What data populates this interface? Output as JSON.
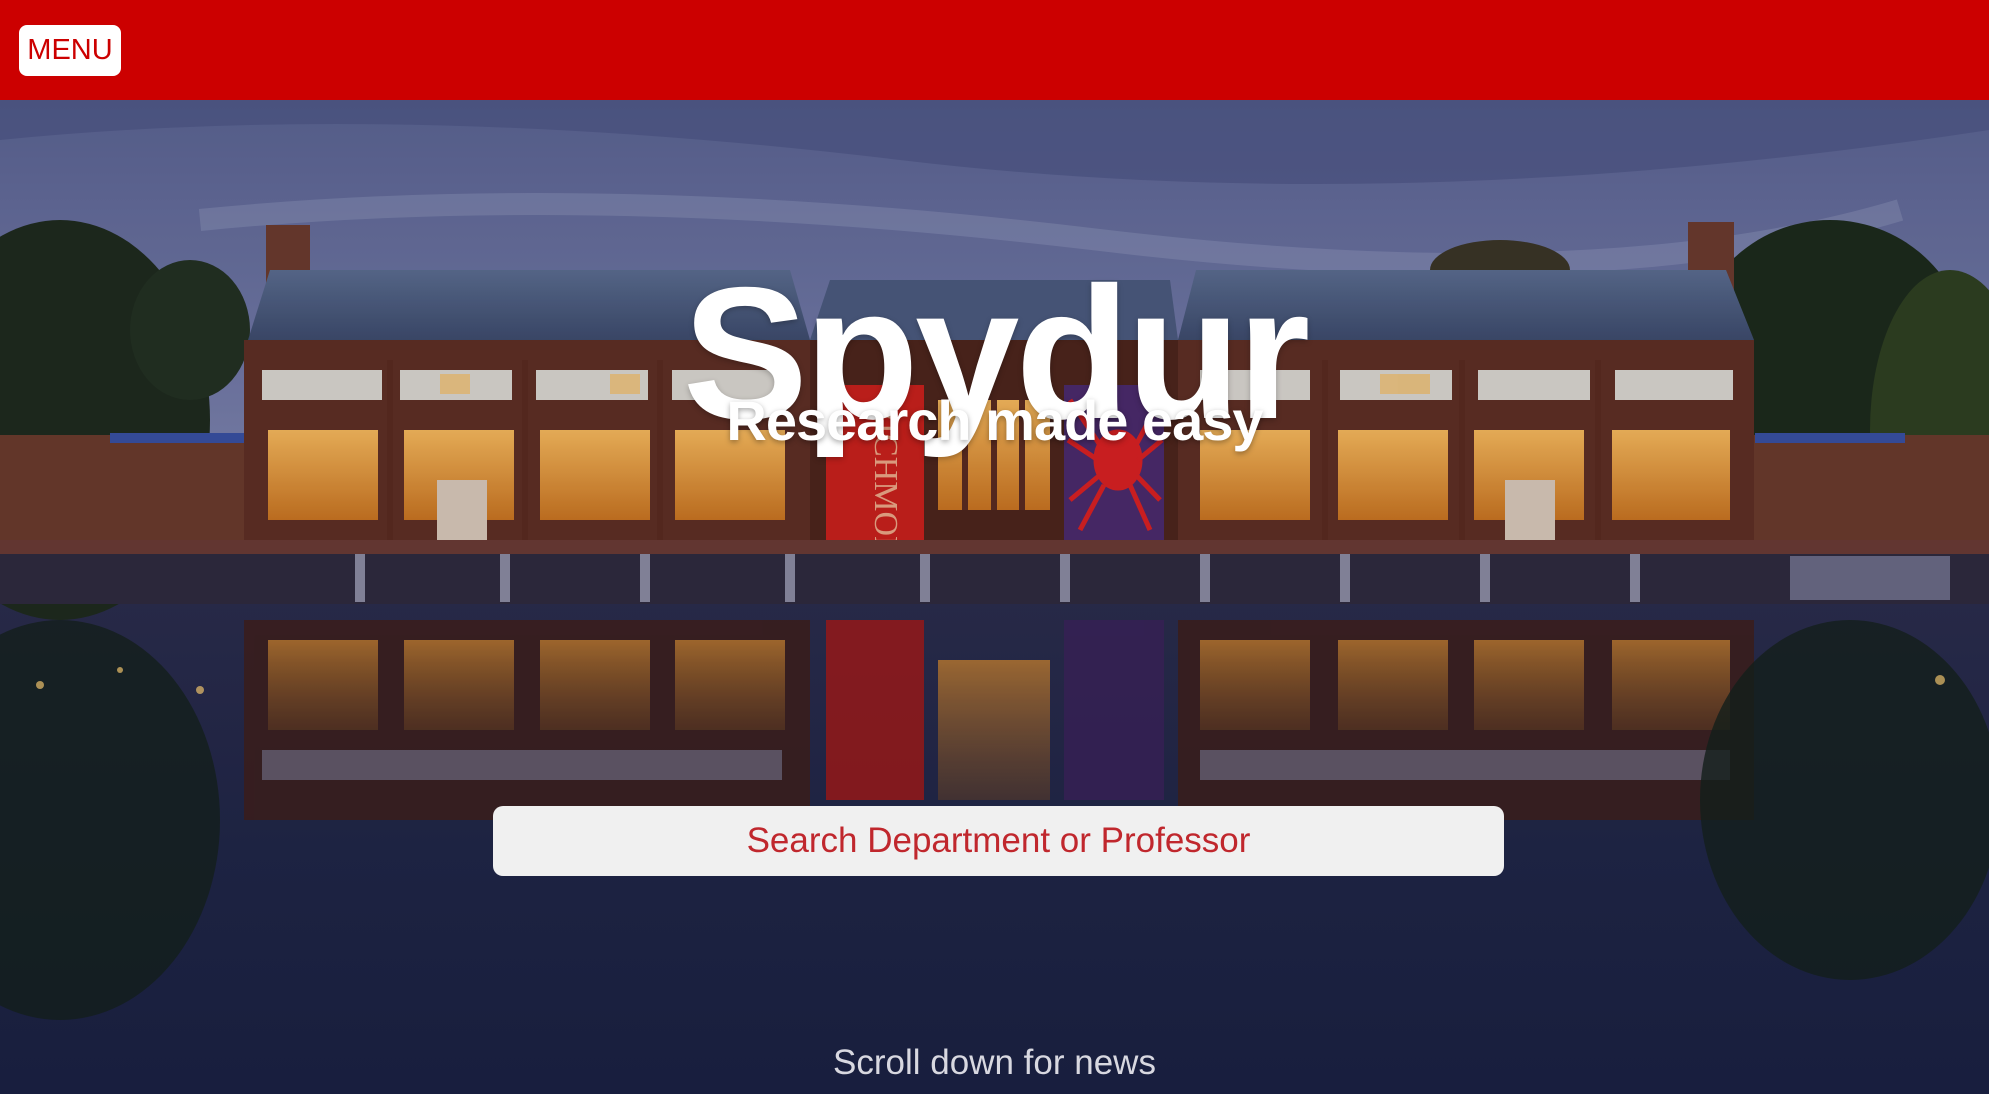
{
  "nav": {
    "menu_label": "MENU"
  },
  "hero": {
    "title": "Spydur",
    "subtitle": "Research made easy",
    "banner_text": "RICHMOND",
    "scroll_hint": "Scroll down for news"
  },
  "search": {
    "placeholder": "Search Department or Professor",
    "value": ""
  },
  "colors": {
    "brand_red": "#cc0000",
    "search_text": "#c0272d",
    "search_bg": "#f0f0f0"
  }
}
